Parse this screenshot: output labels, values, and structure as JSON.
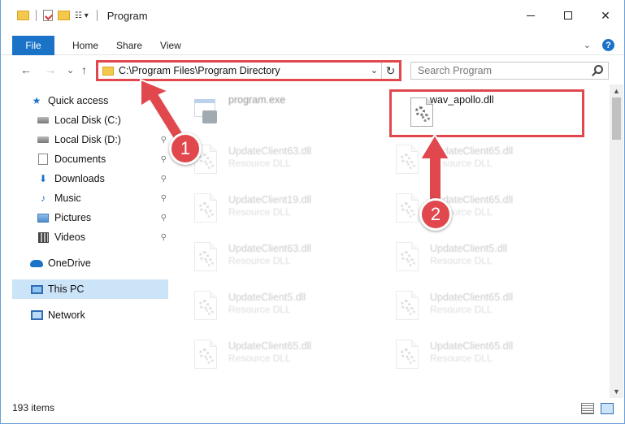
{
  "window": {
    "title": "Program",
    "controls": {
      "minimize": "—",
      "maximize": "☐",
      "close": "✕"
    }
  },
  "ribbon": {
    "file": "File",
    "tabs": [
      "Home",
      "Share",
      "View"
    ],
    "expand": "⌄",
    "help": "?"
  },
  "nav": {
    "back": "←",
    "forward": "→",
    "recent": "⌄",
    "up": "↑"
  },
  "address": {
    "path": "C:\\Program Files\\Program Directory",
    "dropdown": "⌄",
    "refresh": "↻"
  },
  "search": {
    "placeholder": "Search Program"
  },
  "sidebar": {
    "items": [
      {
        "label": "Quick access",
        "icon": "star-icon"
      },
      {
        "label": "Local Disk (C:)",
        "icon": "drive-icon",
        "pinned": true
      },
      {
        "label": "Local Disk (D:)",
        "icon": "drive-icon",
        "pinned": true
      },
      {
        "label": "Documents",
        "icon": "documents-icon",
        "pinned": true
      },
      {
        "label": "Downloads",
        "icon": "download-icon",
        "pinned": true
      },
      {
        "label": "Music",
        "icon": "music-icon",
        "pinned": true
      },
      {
        "label": "Pictures",
        "icon": "pictures-icon",
        "pinned": true
      },
      {
        "label": "Videos",
        "icon": "videos-icon",
        "pinned": true
      },
      {
        "label": "OneDrive",
        "icon": "cloud-icon"
      },
      {
        "label": "This PC",
        "icon": "pc-icon",
        "selected": true
      },
      {
        "label": "Network",
        "icon": "network-icon"
      }
    ],
    "pin_glyph": "📌"
  },
  "files": [
    {
      "name": "program.exe",
      "type": "",
      "icon": "exe-icon"
    },
    {
      "name": "wav_apollo.dll",
      "type": "",
      "icon": "dll-icon",
      "highlighted": true
    },
    {
      "name": "UpdateClient63.dll",
      "type": "Resource DLL",
      "icon": "dll-icon"
    },
    {
      "name": "UpdateClient65.dll",
      "type": "Resource DLL",
      "icon": "dll-icon"
    },
    {
      "name": "UpdateClient19.dll",
      "type": "Resource DLL",
      "icon": "dll-icon"
    },
    {
      "name": "UpdateClient65.dll",
      "type": "Resource DLL",
      "icon": "dll-icon"
    },
    {
      "name": "UpdateClient63.dll",
      "type": "Resource DLL",
      "icon": "dll-icon"
    },
    {
      "name": "UpdateClient5.dll",
      "type": "Resource DLL",
      "icon": "dll-icon"
    },
    {
      "name": "UpdateClient5.dll",
      "type": "Resource DLL",
      "icon": "dll-icon"
    },
    {
      "name": "UpdateClient65.dll",
      "type": "Resource DLL",
      "icon": "dll-icon"
    },
    {
      "name": "UpdateClient65.dll",
      "type": "Resource DLL",
      "icon": "dll-icon"
    },
    {
      "name": "UpdateClient65.dll",
      "type": "Resource DLL",
      "icon": "dll-icon"
    }
  ],
  "status": {
    "item_count": "193 items"
  },
  "annotations": {
    "step1": "1",
    "step2": "2",
    "color": "#e0484e"
  },
  "colors": {
    "accent": "#1a73c7",
    "highlight": "#e0484e",
    "selected_bg": "#cce4f7"
  }
}
